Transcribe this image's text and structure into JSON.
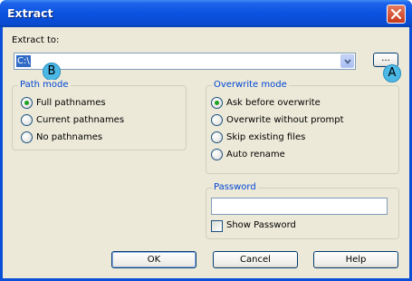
{
  "window": {
    "title": "Extract"
  },
  "extract_to": {
    "label_text": "Extract to:",
    "path_value": "C:\\",
    "browse_label": "..."
  },
  "badges": {
    "a": "A",
    "b": "B"
  },
  "path_mode": {
    "title": "Path mode",
    "options": [
      {
        "label": "Full pathnames",
        "selected": true
      },
      {
        "label": "Current pathnames",
        "selected": false
      },
      {
        "label": "No pathnames",
        "selected": false
      }
    ]
  },
  "overwrite_mode": {
    "title": "Overwrite mode",
    "options": [
      {
        "label": "Ask before overwrite",
        "selected": true
      },
      {
        "label": "Overwrite without prompt",
        "selected": false
      },
      {
        "label": "Skip existing files",
        "selected": false
      },
      {
        "label": "Auto rename",
        "selected": false
      }
    ]
  },
  "password": {
    "title": "Password",
    "value": "",
    "show_label": "Show Password",
    "show_checked": false
  },
  "buttons": {
    "ok": "OK",
    "cancel": "Cancel",
    "help": "Help"
  },
  "colors": {
    "title_bar": "#0a53e0",
    "dialog_bg": "#ece9d8",
    "group_title": "#0046d5",
    "selection": "#316ac5",
    "badge": "#4bb8e6",
    "close_button": "#c8391b"
  },
  "icons": {
    "close": "close-icon",
    "dropdown": "chevron-down-icon"
  }
}
